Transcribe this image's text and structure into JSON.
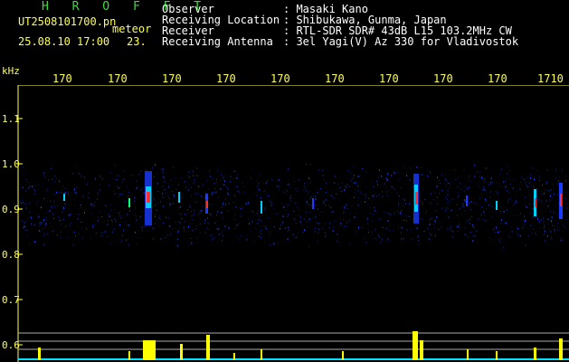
{
  "header": {
    "brand": "H R O F F T",
    "filename": "UT2508101700.pn",
    "label": "meteor",
    "datetime": "25.08.10 17:00",
    "number": "23.",
    "meta": [
      {
        "key": "Observer",
        "value": ": Masaki Kano"
      },
      {
        "key": "Receiving Location",
        "value": ": Shibukawa, Gunma, Japan"
      },
      {
        "key": "Receiver",
        "value": ": RTL-SDR SDR# 43dB L15 103.2MHz CW"
      },
      {
        "key": "Receiving Antenna",
        "value": ": 3el Yagi(V) Az 330 for Vladivostok"
      }
    ]
  },
  "axes": {
    "y_unit": "kHz",
    "time_ticks": [
      "170",
      "170",
      "170",
      "170",
      "170",
      "170",
      "170",
      "170",
      "170",
      "1710"
    ],
    "freq_ticks": [
      "1.1",
      "1.0",
      "0.9",
      "0.8",
      "0.7",
      "0.6"
    ]
  },
  "colors": {
    "header_text": "#ffff55",
    "brand": "#3ddc3d",
    "echo_hot": "#ff3030",
    "amplitude": "#ffff00",
    "baseline": "#00e0ff"
  }
}
